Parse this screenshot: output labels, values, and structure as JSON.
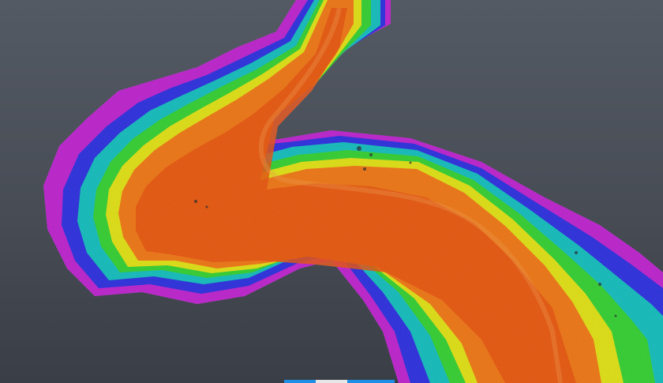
{
  "viewer": {
    "background_top": "#545a64",
    "background_bottom": "#3a3e46",
    "colormap": [
      "#c832d8",
      "#8a2be2",
      "#3a3ae6",
      "#1e8fe6",
      "#19c9b4",
      "#3ad23c",
      "#c8e61e",
      "#ffd21e",
      "#ff9a1e",
      "#f06a1e",
      "#e0841e"
    ]
  }
}
